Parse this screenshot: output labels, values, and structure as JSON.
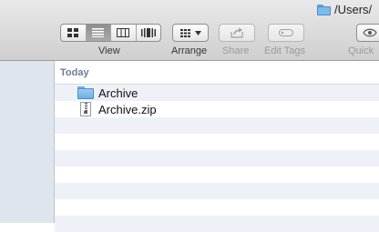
{
  "window": {
    "path": "/Users/"
  },
  "toolbar": {
    "view_label": "View",
    "arrange_label": "Arrange",
    "share_label": "Share",
    "edit_tags_label": "Edit Tags",
    "quick_label": "Quick",
    "view_modes": [
      "icon",
      "list",
      "column",
      "cover-flow"
    ],
    "selected_view": "list"
  },
  "content": {
    "group_header": "Today",
    "items": [
      {
        "name": "Archive",
        "icon": "folder-icon"
      },
      {
        "name": "Archive.zip",
        "icon": "zip-file-icon"
      }
    ]
  }
}
